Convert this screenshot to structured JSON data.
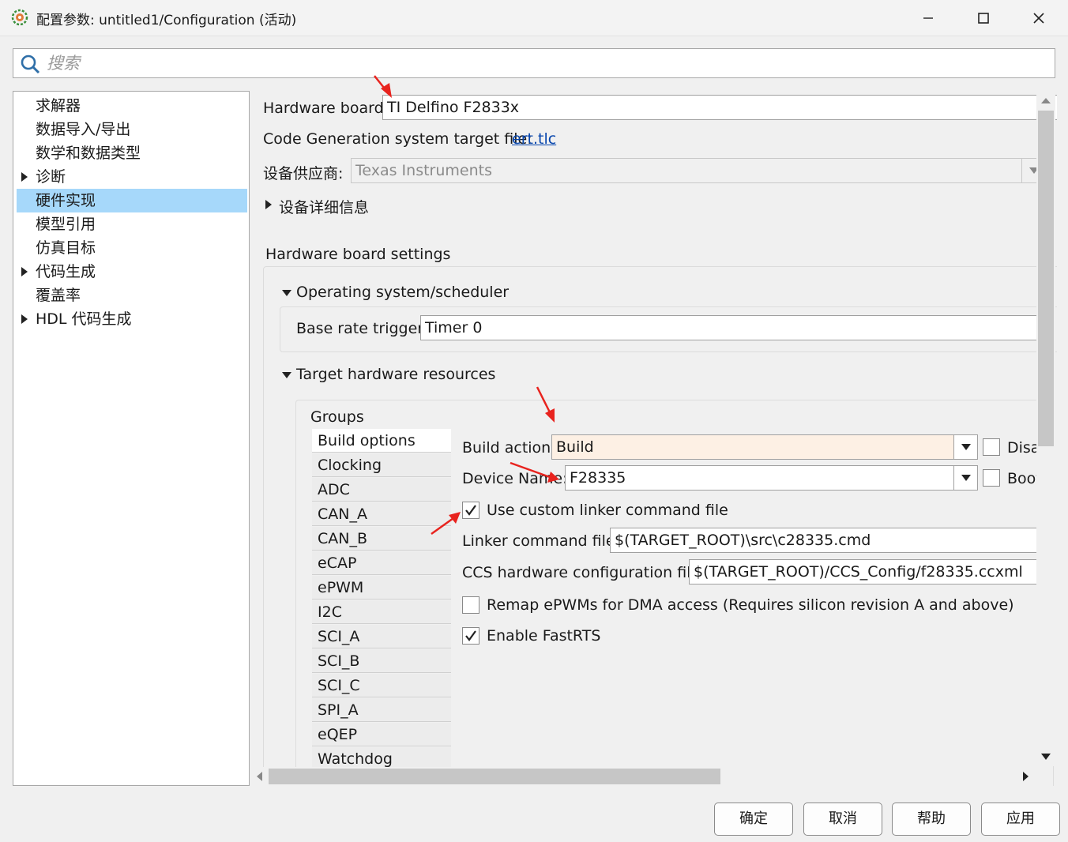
{
  "window": {
    "title": "配置参数: untitled1/Configuration (活动)",
    "icons": [
      "simulink-gear-icon",
      "minimize-icon",
      "maximize-icon",
      "close-icon"
    ]
  },
  "search": {
    "placeholder": "搜索",
    "value": ""
  },
  "tree": {
    "items": [
      {
        "label": "求解器",
        "expandable": false,
        "selected": false
      },
      {
        "label": "数据导入/导出",
        "expandable": false,
        "selected": false
      },
      {
        "label": "数学和数据类型",
        "expandable": false,
        "selected": false
      },
      {
        "label": "诊断",
        "expandable": true,
        "selected": false
      },
      {
        "label": "硬件实现",
        "expandable": false,
        "selected": true
      },
      {
        "label": "模型引用",
        "expandable": false,
        "selected": false
      },
      {
        "label": "仿真目标",
        "expandable": false,
        "selected": false
      },
      {
        "label": "代码生成",
        "expandable": true,
        "selected": false
      },
      {
        "label": "覆盖率",
        "expandable": false,
        "selected": false
      },
      {
        "label": "HDL 代码生成",
        "expandable": true,
        "selected": false
      }
    ]
  },
  "main": {
    "hardware_board_label": "Hardware board:",
    "hardware_board_value": "TI Delfino F2833x",
    "target_file_label": "Code Generation system target file:",
    "target_file_link": "ert.tlc",
    "vendor_label": "设备供应商:",
    "vendor_value": "Texas Instruments",
    "device_details_label": "设备详细信息",
    "board_settings_title": "Hardware board settings",
    "os_section_title": "Operating system/scheduler",
    "base_rate_label": "Base rate trigger:",
    "base_rate_value": "Timer 0",
    "resources_section_title": "Target hardware resources",
    "groups_label": "Groups",
    "groups": [
      "Build options",
      "Clocking",
      "ADC",
      "CAN_A",
      "CAN_B",
      "eCAP",
      "ePWM",
      "I2C",
      "SCI_A",
      "SCI_B",
      "SCI_C",
      "SPI_A",
      "eQEP",
      "Watchdog"
    ],
    "selected_group": "Build options",
    "build_action_label": "Build action:",
    "build_action_value": "Build",
    "disable_label": "Disa",
    "device_name_label": "Device Name:",
    "device_name_value": "F28335",
    "boot_label": "Boot",
    "custom_linker_label": "Use custom linker command file",
    "custom_linker_checked": true,
    "linker_file_label": "Linker command file:",
    "linker_file_value": "$(TARGET_ROOT)\\src\\c28335.cmd",
    "ccs_config_label": "CCS hardware configuration file:",
    "ccs_config_value": "$(TARGET_ROOT)/CCS_Config/f28335.ccxml",
    "remap_label": "Remap ePWMs for DMA access (Requires silicon revision A and above)",
    "remap_checked": false,
    "fastrts_label": "Enable FastRTS",
    "fastrts_checked": true
  },
  "buttons": {
    "ok": "确定",
    "cancel": "取消",
    "help": "帮助",
    "apply": "应用"
  },
  "colors": {
    "tree_selection": "#a6d8fa",
    "build_field": "#fdf0e4",
    "annotation_arrow": "#e8231e",
    "link": "#0645ad"
  }
}
